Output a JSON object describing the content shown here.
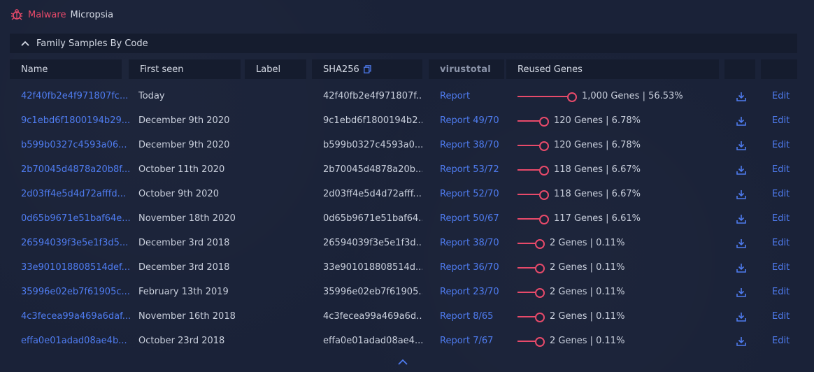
{
  "app": {
    "brand_red": "Malware",
    "brand_white": "Micropsia"
  },
  "panel": {
    "title": "Family Samples By Code"
  },
  "columns": {
    "name": "Name",
    "first_seen": "First seen",
    "label": "Label",
    "sha256": "SHA256",
    "virustotal": "virustotal",
    "reused": "Reused Genes"
  },
  "rows": [
    {
      "name": "42f40fb2e4f971807fc...",
      "seen": "Today",
      "sha": "42f40fb2e4f971807f...",
      "vt": "Report",
      "genes": "1,000 Genes | 56.53%",
      "pct": 56.53,
      "edit": "Edit"
    },
    {
      "name": "9c1ebd6f1800194b29...",
      "seen": "December 9th 2020",
      "sha": "9c1ebd6f1800194b2...",
      "vt": "Report 49/70",
      "genes": "120 Genes | 6.78%",
      "pct": 6.78,
      "edit": "Edit"
    },
    {
      "name": "b599b0327c4593a06...",
      "seen": "December 9th 2020",
      "sha": "b599b0327c4593a0...",
      "vt": "Report 38/70",
      "genes": "120 Genes | 6.78%",
      "pct": 6.78,
      "edit": "Edit"
    },
    {
      "name": "2b70045d4878a20b8f...",
      "seen": "October 11th 2020",
      "sha": "2b70045d4878a20b...",
      "vt": "Report 53/72",
      "genes": "118 Genes | 6.67%",
      "pct": 6.67,
      "edit": "Edit"
    },
    {
      "name": "2d03ff4e5d4d72afffd...",
      "seen": "October 9th 2020",
      "sha": "2d03ff4e5d4d72afff...",
      "vt": "Report 52/70",
      "genes": "118 Genes | 6.67%",
      "pct": 6.67,
      "edit": "Edit"
    },
    {
      "name": "0d65b9671e51baf64e...",
      "seen": "November 18th 2020",
      "sha": "0d65b9671e51baf64...",
      "vt": "Report 50/67",
      "genes": "117 Genes | 6.61%",
      "pct": 6.61,
      "edit": "Edit"
    },
    {
      "name": "26594039f3e5e1f3d5...",
      "seen": "December 3rd 2018",
      "sha": "26594039f3e5e1f3d...",
      "vt": "Report 38/70",
      "genes": "2 Genes | 0.11%",
      "pct": 0.11,
      "edit": "Edit"
    },
    {
      "name": "33e901018808514def...",
      "seen": "December 3rd 2018",
      "sha": "33e901018808514d...",
      "vt": "Report 36/70",
      "genes": "2 Genes | 0.11%",
      "pct": 0.11,
      "edit": "Edit"
    },
    {
      "name": "35996e02eb7f61905c...",
      "seen": "February 13th 2019",
      "sha": "35996e02eb7f61905...",
      "vt": "Report 23/70",
      "genes": "2 Genes | 0.11%",
      "pct": 0.11,
      "edit": "Edit"
    },
    {
      "name": "4c3fecea99a469a6daf...",
      "seen": "November 16th 2018",
      "sha": "4c3fecea99a469a6d...",
      "vt": "Report 8/65",
      "genes": "2 Genes | 0.11%",
      "pct": 0.11,
      "edit": "Edit"
    },
    {
      "name": "effa0e01adad08ae4b...",
      "seen": "October 23rd 2018",
      "sha": "effa0e01adad08ae4...",
      "vt": "Report 7/67",
      "genes": "2 Genes | 0.11%",
      "pct": 0.11,
      "edit": "Edit"
    }
  ],
  "colors": {
    "accent": "#e84a6a",
    "link": "#4f7cf0",
    "bg": "#1a2238",
    "header_bg": "#151c2e"
  },
  "icons": {
    "logo": "bug-icon",
    "collapse": "chevron-up-icon",
    "copy": "copy-icon",
    "download": "download-icon"
  }
}
